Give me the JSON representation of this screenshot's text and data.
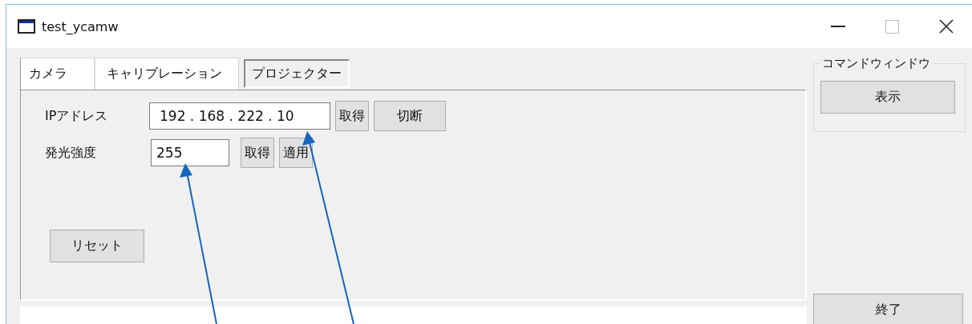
{
  "window": {
    "title": "test_ycamw"
  },
  "tabs": [
    {
      "label": "カメラ",
      "selected": false
    },
    {
      "label": "キャリブレーション",
      "selected": false
    },
    {
      "label": "プロジェクター",
      "selected": true
    }
  ],
  "rows": [
    {
      "label": "IPアドレス",
      "value": "192 . 168 . 222 . 10",
      "buttons": [
        "取得",
        "切断"
      ]
    },
    {
      "label": "発光強度",
      "value": "255",
      "buttons": [
        "取得",
        "適用"
      ]
    }
  ],
  "reset_button": "リセット",
  "command_window": {
    "title": "コマンドウィンドウ",
    "button": "表示"
  },
  "exit_button": "終了"
}
